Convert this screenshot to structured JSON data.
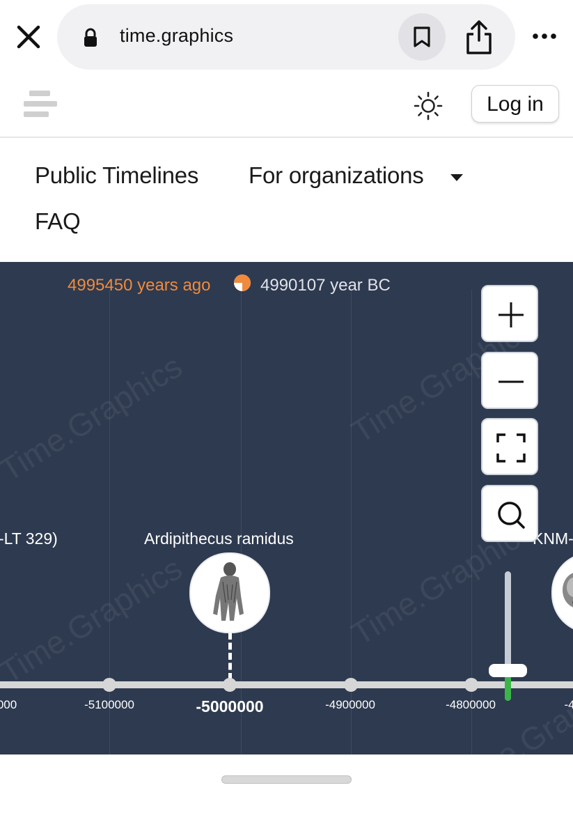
{
  "browser": {
    "url": "time.graphics",
    "icons": [
      "close-icon",
      "lock-icon",
      "bookmark-icon",
      "share-icon",
      "more-icon"
    ]
  },
  "header": {
    "logo_icon": "menu-logo-icon",
    "theme_icon": "sun-icon",
    "login_label": "Log in"
  },
  "nav": {
    "public_timelines": "Public Timelines",
    "for_organizations": "For organizations",
    "faq": "FAQ"
  },
  "timeline": {
    "years_ago": "4995450 years ago",
    "year_bc": "4990107 year BC",
    "watermark": "Time.Graphics",
    "events": [
      {
        "label": "-LT 329)"
      },
      {
        "label": "Ardipithecus ramidus"
      },
      {
        "label": "KNM-"
      }
    ],
    "ticks": [
      "000",
      "-5100000",
      "-5000000",
      "-4900000",
      "-4800000",
      "-4"
    ],
    "controls": [
      "plus-icon",
      "minus-icon",
      "fullscreen-icon",
      "search-icon"
    ]
  },
  "colors": {
    "accent_orange": "#f08a3c",
    "timeline_bg": "#2e3a4f",
    "zoom_green": "#3bb54a"
  }
}
